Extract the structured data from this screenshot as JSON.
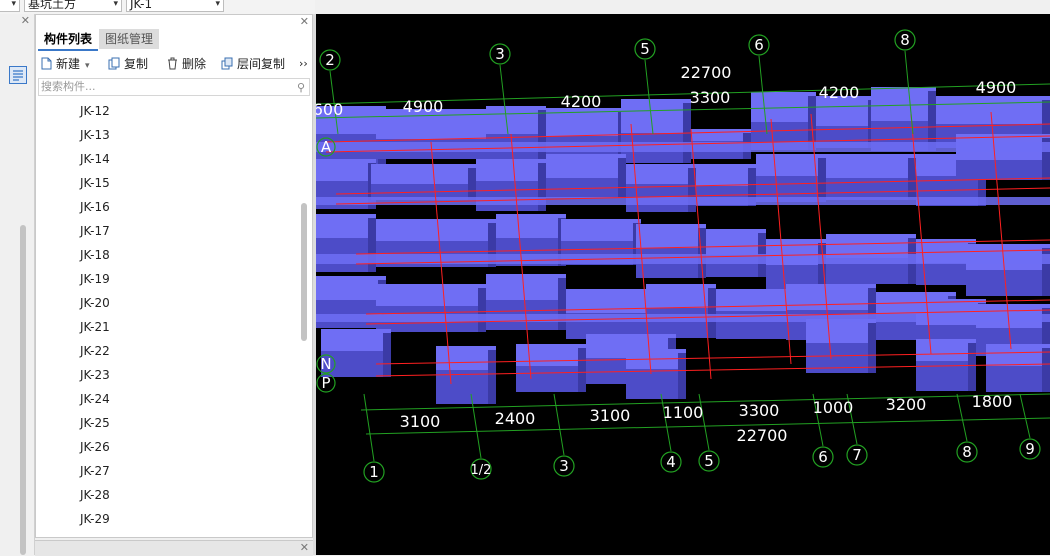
{
  "top": {
    "combo1": "基坑土方",
    "combo2": "JK-1"
  },
  "panel": {
    "tabs": [
      "构件列表",
      "图纸管理"
    ],
    "toolbar": {
      "new_label": "新建",
      "copy_label": "复制",
      "delete_label": "删除",
      "floor_copy_label": "层间复制",
      "more": "››"
    },
    "search_placeholder": "搜索构件...",
    "items": [
      "JK-12",
      "JK-13",
      "JK-14",
      "JK-15",
      "JK-16",
      "JK-17",
      "JK-18",
      "JK-19",
      "JK-20",
      "JK-21",
      "JK-22",
      "JK-23",
      "JK-24",
      "JK-25",
      "JK-26",
      "JK-27",
      "JK-28",
      "JK-29"
    ]
  },
  "viewport": {
    "top_axes": [
      "2",
      "3",
      "5",
      "6",
      "8"
    ],
    "top_total": "22700",
    "top_dims": [
      "600",
      "4900",
      "4200",
      "3300",
      "4200",
      "4900"
    ],
    "bottom_axes": [
      "1",
      "1/2",
      "3",
      "4",
      "5",
      "6",
      "7",
      "8",
      "9"
    ],
    "bottom_dims": [
      "3100",
      "2400",
      "3100",
      "1100",
      "3300",
      "1000",
      "3200",
      "1800"
    ],
    "bottom_total": "22700",
    "left_axes": [
      "A",
      "N",
      "P"
    ],
    "colors": {
      "background": "#000000",
      "block_top": "#6f6ef4",
      "block_front": "#4d4cc8",
      "grid": "#22a022",
      "red_line": "#ff2020",
      "dim_text": "#ffffff"
    }
  }
}
